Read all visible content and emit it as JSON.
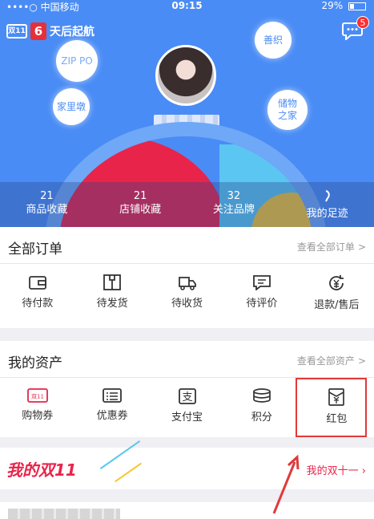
{
  "status_bar": {
    "carrier": "••••○ 中国移动",
    "time": "09:15",
    "battery": "29%",
    "battery_level": 0.29
  },
  "header": {
    "promo_text": "天后起航",
    "promo_day": "6",
    "message_badge": "5",
    "bubbles": {
      "zip": "ZIP PO",
      "jiali": "家里墩",
      "shanzhi": "善织",
      "chuwu": "储物之家"
    },
    "stats": [
      {
        "count": "21",
        "label": "商品收藏"
      },
      {
        "count": "21",
        "label": "店铺收藏"
      },
      {
        "count": "32",
        "label": "关注品牌"
      },
      {
        "count": "",
        "label": "我的足迹"
      }
    ]
  },
  "orders": {
    "title": "全部订单",
    "link": "查看全部订单",
    "items": [
      {
        "label": "待付款",
        "icon": "wallet-icon"
      },
      {
        "label": "待发货",
        "icon": "package-icon"
      },
      {
        "label": "待收货",
        "icon": "truck-icon"
      },
      {
        "label": "待评价",
        "icon": "comment-icon"
      },
      {
        "label": "退款/售后",
        "icon": "refund-icon"
      }
    ]
  },
  "assets": {
    "title": "我的资产",
    "link": "查看全部资产",
    "items": [
      {
        "label": "购物券",
        "icon": "shopping-coupon-icon"
      },
      {
        "label": "优惠券",
        "icon": "discount-coupon-icon"
      },
      {
        "label": "支付宝",
        "icon": "alipay-icon"
      },
      {
        "label": "积分",
        "icon": "points-icon"
      },
      {
        "label": "红包",
        "icon": "red-packet-icon"
      }
    ]
  },
  "banner": {
    "left": "我的双11",
    "right": "我的双十一",
    "chevron": "›"
  },
  "colors": {
    "hero_bg": "#4a8cf5",
    "accent_red": "#e8244a",
    "highlight_box": "#e03a3a"
  }
}
